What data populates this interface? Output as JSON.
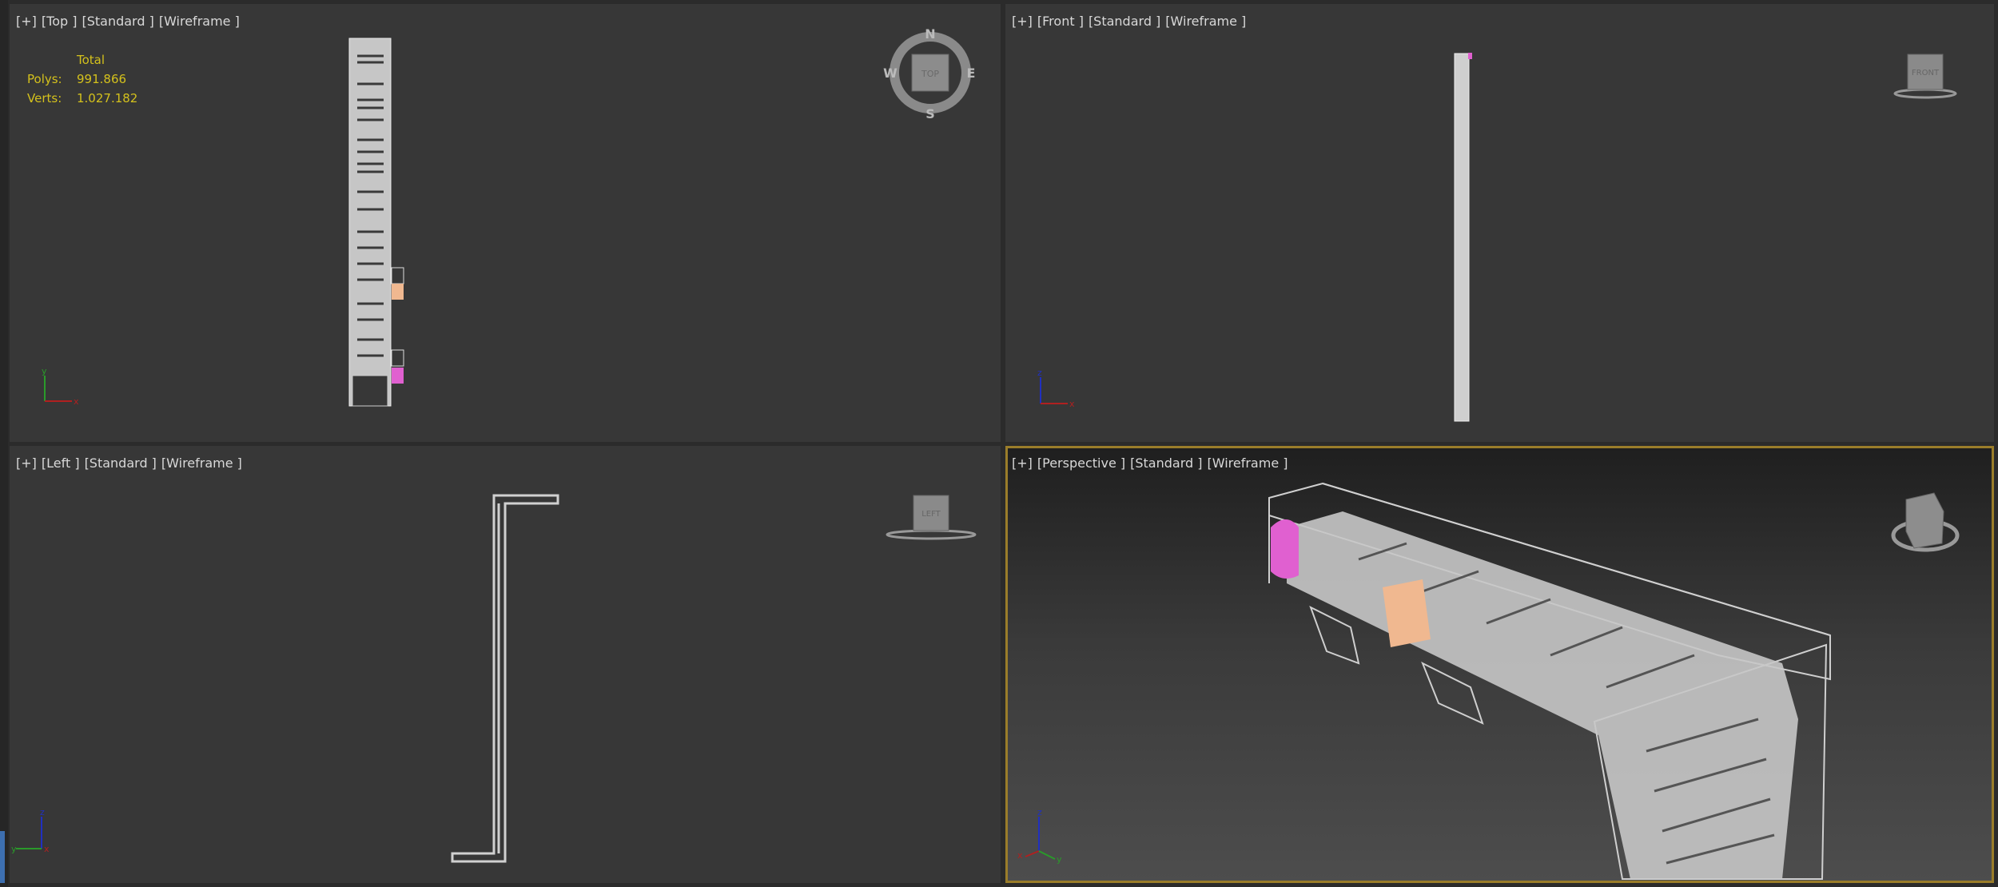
{
  "viewports": {
    "top": {
      "labels": [
        "[+]",
        "[Top ]",
        "[Standard ]",
        "[Wireframe ]"
      ],
      "viewcube": "TOP",
      "compass": {
        "n": "N",
        "s": "S",
        "e": "E",
        "w": "W"
      }
    },
    "front": {
      "labels": [
        "[+]",
        "[Front ]",
        "[Standard ]",
        "[Wireframe ]"
      ],
      "viewcube": "FRONT"
    },
    "left": {
      "labels": [
        "[+]",
        "[Left ]",
        "[Standard ]",
        "[Wireframe ]"
      ],
      "viewcube": "LEFT"
    },
    "perspective": {
      "labels": [
        "[+]",
        "[Perspective ]",
        "[Standard ]",
        "[Wireframe ]"
      ],
      "active": true
    }
  },
  "stats": {
    "header": "Total",
    "polys_label": "Polys:",
    "polys": "991.866",
    "verts_label": "Verts:",
    "verts": "1.027.182"
  },
  "axes": {
    "x": "x",
    "y": "y",
    "z": "z"
  },
  "colors": {
    "stats": "#d4c11c",
    "active_border": "#9a7d2a",
    "pink": "#e060d0",
    "peach": "#f0b890",
    "wire": "#c8c8c8"
  }
}
